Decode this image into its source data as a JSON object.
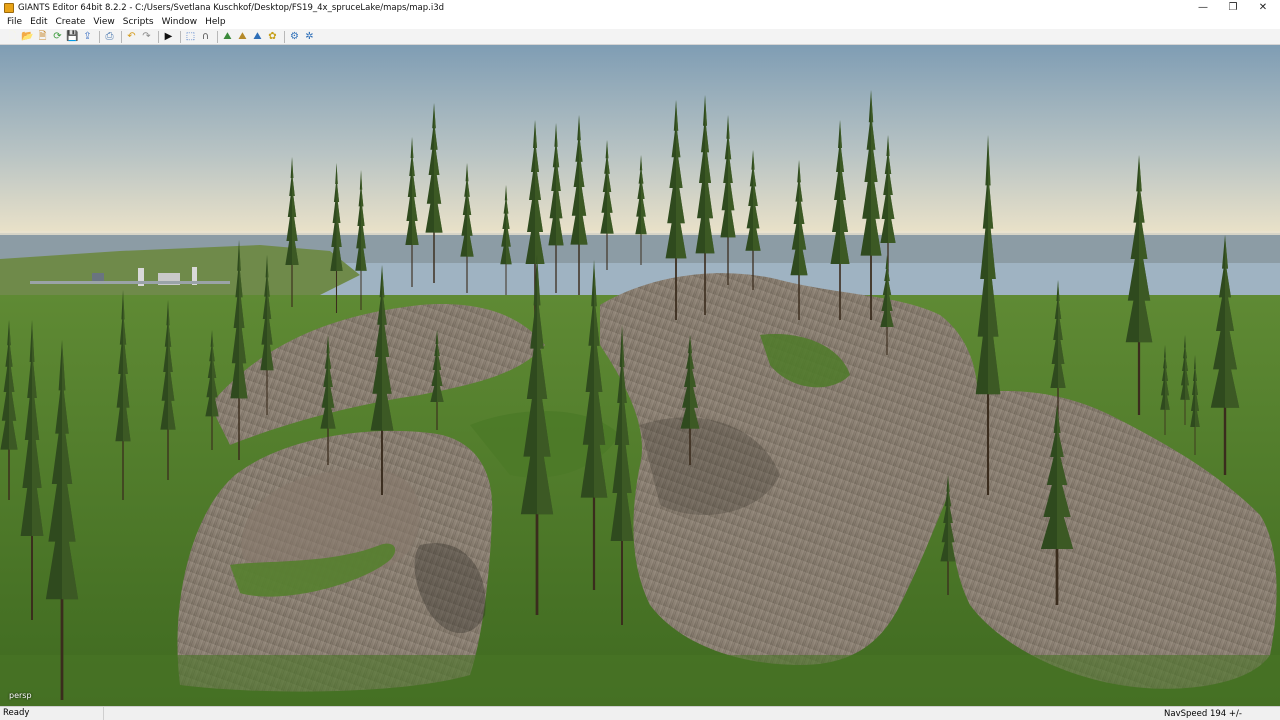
{
  "window": {
    "title": "GIANTS Editor 64bit 8.2.2 - C:/Users/Svetlana Kuschkof/Desktop/FS19_4x_spruceLake/maps/map.i3d",
    "minimize_glyph": "—",
    "maximize_glyph": "❐",
    "close_glyph": "✕"
  },
  "menu": {
    "items": [
      "File",
      "Edit",
      "Create",
      "View",
      "Scripts",
      "Window",
      "Help"
    ]
  },
  "toolbar": {
    "buttons": [
      {
        "icon": "new-file-icon",
        "glyph": "🗋",
        "color": "#f5f5e8"
      },
      {
        "icon": "open-folder-icon",
        "glyph": "📂",
        "color": "#d9a441"
      },
      {
        "icon": "import-icon",
        "glyph": "🗎",
        "color": "#c98a2d"
      },
      {
        "icon": "reload-icon",
        "glyph": "⟳",
        "color": "#3a9a3a"
      },
      {
        "icon": "save-icon",
        "glyph": "💾",
        "color": "#3a6fc4"
      },
      {
        "icon": "export-icon",
        "glyph": "⇪",
        "color": "#3a6fc4"
      },
      {
        "icon": "separator"
      },
      {
        "icon": "save-all-icon",
        "glyph": "⎙",
        "color": "#4a78b0"
      },
      {
        "icon": "separator"
      },
      {
        "icon": "undo-icon",
        "glyph": "↶",
        "color": "#d49a1a"
      },
      {
        "icon": "redo-icon",
        "glyph": "↷",
        "color": "#8a8a8a"
      },
      {
        "icon": "separator"
      },
      {
        "icon": "play-icon",
        "glyph": "▶",
        "color": "#111111"
      },
      {
        "icon": "separator"
      },
      {
        "icon": "select-mode-icon",
        "glyph": "⬚",
        "color": "#3a6fc4"
      },
      {
        "icon": "snap-icon",
        "glyph": "∩",
        "color": "#555555"
      },
      {
        "icon": "separator"
      },
      {
        "icon": "terrain-sculpt-icon",
        "glyph": "⛰",
        "color": "#3c8a3c"
      },
      {
        "icon": "terrain-paint-icon",
        "glyph": "⛰",
        "color": "#b58a2a"
      },
      {
        "icon": "foliage-paint-icon",
        "glyph": "⛰",
        "color": "#2e6fb8"
      },
      {
        "icon": "placement-icon",
        "glyph": "✿",
        "color": "#c7a01a"
      },
      {
        "icon": "separator"
      },
      {
        "icon": "settings-icon",
        "glyph": "⚙",
        "color": "#2e6fb8"
      },
      {
        "icon": "camera-settings-icon",
        "glyph": "✲",
        "color": "#2e6fb8"
      }
    ]
  },
  "viewport": {
    "camera_label": "persp",
    "colors": {
      "sky_top": "#7f9db4",
      "sky_horizon": "#f1e6c9",
      "water": "#8a9aa3",
      "grass": "#4f7a2a",
      "rock": "#8a7f72",
      "tree": "#2f4a1e"
    }
  },
  "status": {
    "left": "Ready",
    "nav_speed": "NavSpeed 194 +/-"
  }
}
